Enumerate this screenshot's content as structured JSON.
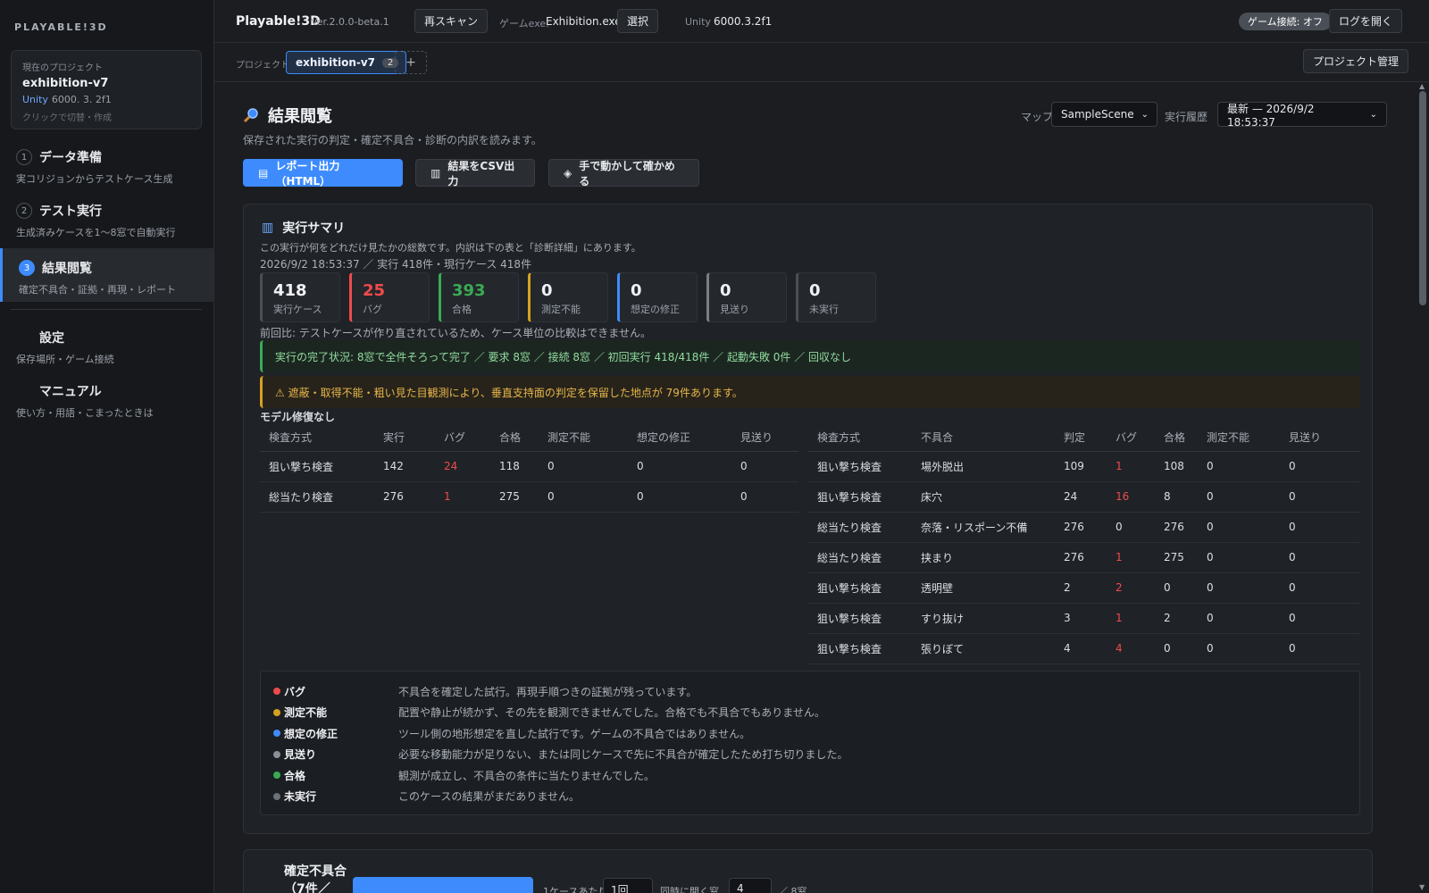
{
  "sidebar": {
    "brand": "PLAYABLE!3D",
    "project_card": {
      "label": "現在のプロジェクト",
      "name": "exhibition-v7",
      "unity_tag": "Unity",
      "unity_version": "6000. 3. 2f1",
      "hint": "クリックで切替・作成"
    },
    "nav": [
      {
        "num": "1",
        "title": "データ準備",
        "sub": "実コリジョンからテストケース生成"
      },
      {
        "num": "2",
        "title": "テスト実行",
        "sub": "生成済みケースを1〜8窓で自動実行"
      },
      {
        "num": "3",
        "title": "結果閲覧",
        "sub": "確定不具合・証拠・再現・レポート"
      },
      {
        "title": "設定",
        "sub": "保存場所・ゲーム接続"
      },
      {
        "title": "マニュアル",
        "sub": "使い方・用語・こまったときは"
      }
    ]
  },
  "topbar": {
    "app": "Playable!3D",
    "version": "Ver.2.0.0-beta.1",
    "rescan": "再スキャン",
    "exe_label": "ゲームexe:",
    "exe_value": "Exhibition.exe",
    "select": "選択",
    "unity_label": "Unity",
    "unity_value": "6000.3.2f1",
    "connection": "ゲーム接続: オフ",
    "open_log": "ログを開く"
  },
  "projbar": {
    "label": "プロジェクト",
    "tab": "exhibition-v7",
    "tab_badge": "2",
    "add": "+",
    "manage": "プロジェクト管理"
  },
  "page": {
    "title": "結果閲覧",
    "subtitle": "保存された実行の判定・確定不具合・診断の内訳を読みます。",
    "map_label": "マップ",
    "map_value": "SampleScene",
    "history_label": "実行履歴",
    "history_value": "最新 — 2026/9/2 18:53:37",
    "btn_report": "レポート出力（HTML）",
    "btn_csv": "結果をCSV出力",
    "btn_manual": "手で動かして確かめる"
  },
  "summary": {
    "title": "実行サマリ",
    "desc": "この実行が何をどれだけ見たかの総数です。内訳は下の表と「診断詳細」にあります。",
    "meta": "2026/9/2 18:53:37 ／ 実行 418件・現行ケース 418件",
    "stats": [
      {
        "value": "418",
        "label": "実行ケース",
        "color": "#4a4f57"
      },
      {
        "value": "25",
        "label": "バグ",
        "color": "#ef4b4b"
      },
      {
        "value": "393",
        "label": "合格",
        "color": "#3aaa55"
      },
      {
        "value": "0",
        "label": "測定不能",
        "color": "#d6a020"
      },
      {
        "value": "0",
        "label": "想定の修正",
        "color": "#3d8bfd"
      },
      {
        "value": "0",
        "label": "見送り",
        "color": "#7a7f87"
      },
      {
        "value": "0",
        "label": "未実行",
        "color": "#4a4f57"
      }
    ],
    "prev_note": "前回比: テストケースが作り直されているため、ケース単位の比較はできません。",
    "banner_ok": "実行の完了状況: 8窓で全件そろって完了 ／ 要求 8窓 ／ 接続 8窓 ／ 初回実行 418/418件 ／ 起動失敗 0件 ／ 回収なし",
    "banner_warn": "⚠ 遮蔽・取得不能・粗い見た目観測により、垂直支持面の判定を保留した地点が 79件あります。",
    "model_label": "モデル修復なし"
  },
  "table_left": {
    "headers": [
      "検査方式",
      "実行",
      "バグ",
      "合格",
      "測定不能",
      "想定の修正",
      "見送り"
    ],
    "rows": [
      [
        "狙い撃ち検査",
        "142",
        "24",
        "118",
        "0",
        "0",
        "0"
      ],
      [
        "総当たり検査",
        "276",
        "1",
        "275",
        "0",
        "0",
        "0"
      ]
    ]
  },
  "table_right": {
    "headers": [
      "検査方式",
      "不具合",
      "判定",
      "バグ",
      "合格",
      "測定不能",
      "見送り"
    ],
    "rows": [
      [
        "狙い撃ち検査",
        "場外脱出",
        "109",
        "1",
        "108",
        "0",
        "0"
      ],
      [
        "狙い撃ち検査",
        "床穴",
        "24",
        "16",
        "8",
        "0",
        "0"
      ],
      [
        "総当たり検査",
        "奈落・リスポーン不備",
        "276",
        "0",
        "276",
        "0",
        "0"
      ],
      [
        "総当たり検査",
        "挟まり",
        "276",
        "1",
        "275",
        "0",
        "0"
      ],
      [
        "狙い撃ち検査",
        "透明壁",
        "2",
        "2",
        "0",
        "0",
        "0"
      ],
      [
        "狙い撃ち検査",
        "すり抜け",
        "3",
        "1",
        "2",
        "0",
        "0"
      ],
      [
        "狙い撃ち検査",
        "張りぼて",
        "4",
        "4",
        "0",
        "0",
        "0"
      ]
    ]
  },
  "legend": [
    {
      "key": "バグ",
      "desc": "不具合を確定した試行。再現手順つきの証拠が残っています。",
      "color": "#ef4b4b"
    },
    {
      "key": "測定不能",
      "desc": "配置や静止が続かず、その先を観測できませんでした。合格でも不具合でもありません。",
      "color": "#d6a020"
    },
    {
      "key": "想定の修正",
      "desc": "ツール側の地形想定を直した試行です。ゲームの不具合ではありません。",
      "color": "#3d8bfd"
    },
    {
      "key": "見送り",
      "desc": "必要な移動能力が足りない、または同じケースで先に不具合が確定したため打ち切りました。",
      "color": "#8a8f97"
    },
    {
      "key": "合格",
      "desc": "観測が成立し、不具合の条件に当たりませんでした。",
      "color": "#3aaa55"
    },
    {
      "key": "未実行",
      "desc": "このケースの結果がまだありません。",
      "color": "#6b7179"
    }
  ],
  "panel2": {
    "title": "確定不具合（7件／",
    "per_case_label": "1ケースあたり",
    "per_case_value": "1回",
    "windows_label": "同時に開く窓",
    "windows_value": "4",
    "windows_max": "／ 8窓"
  }
}
